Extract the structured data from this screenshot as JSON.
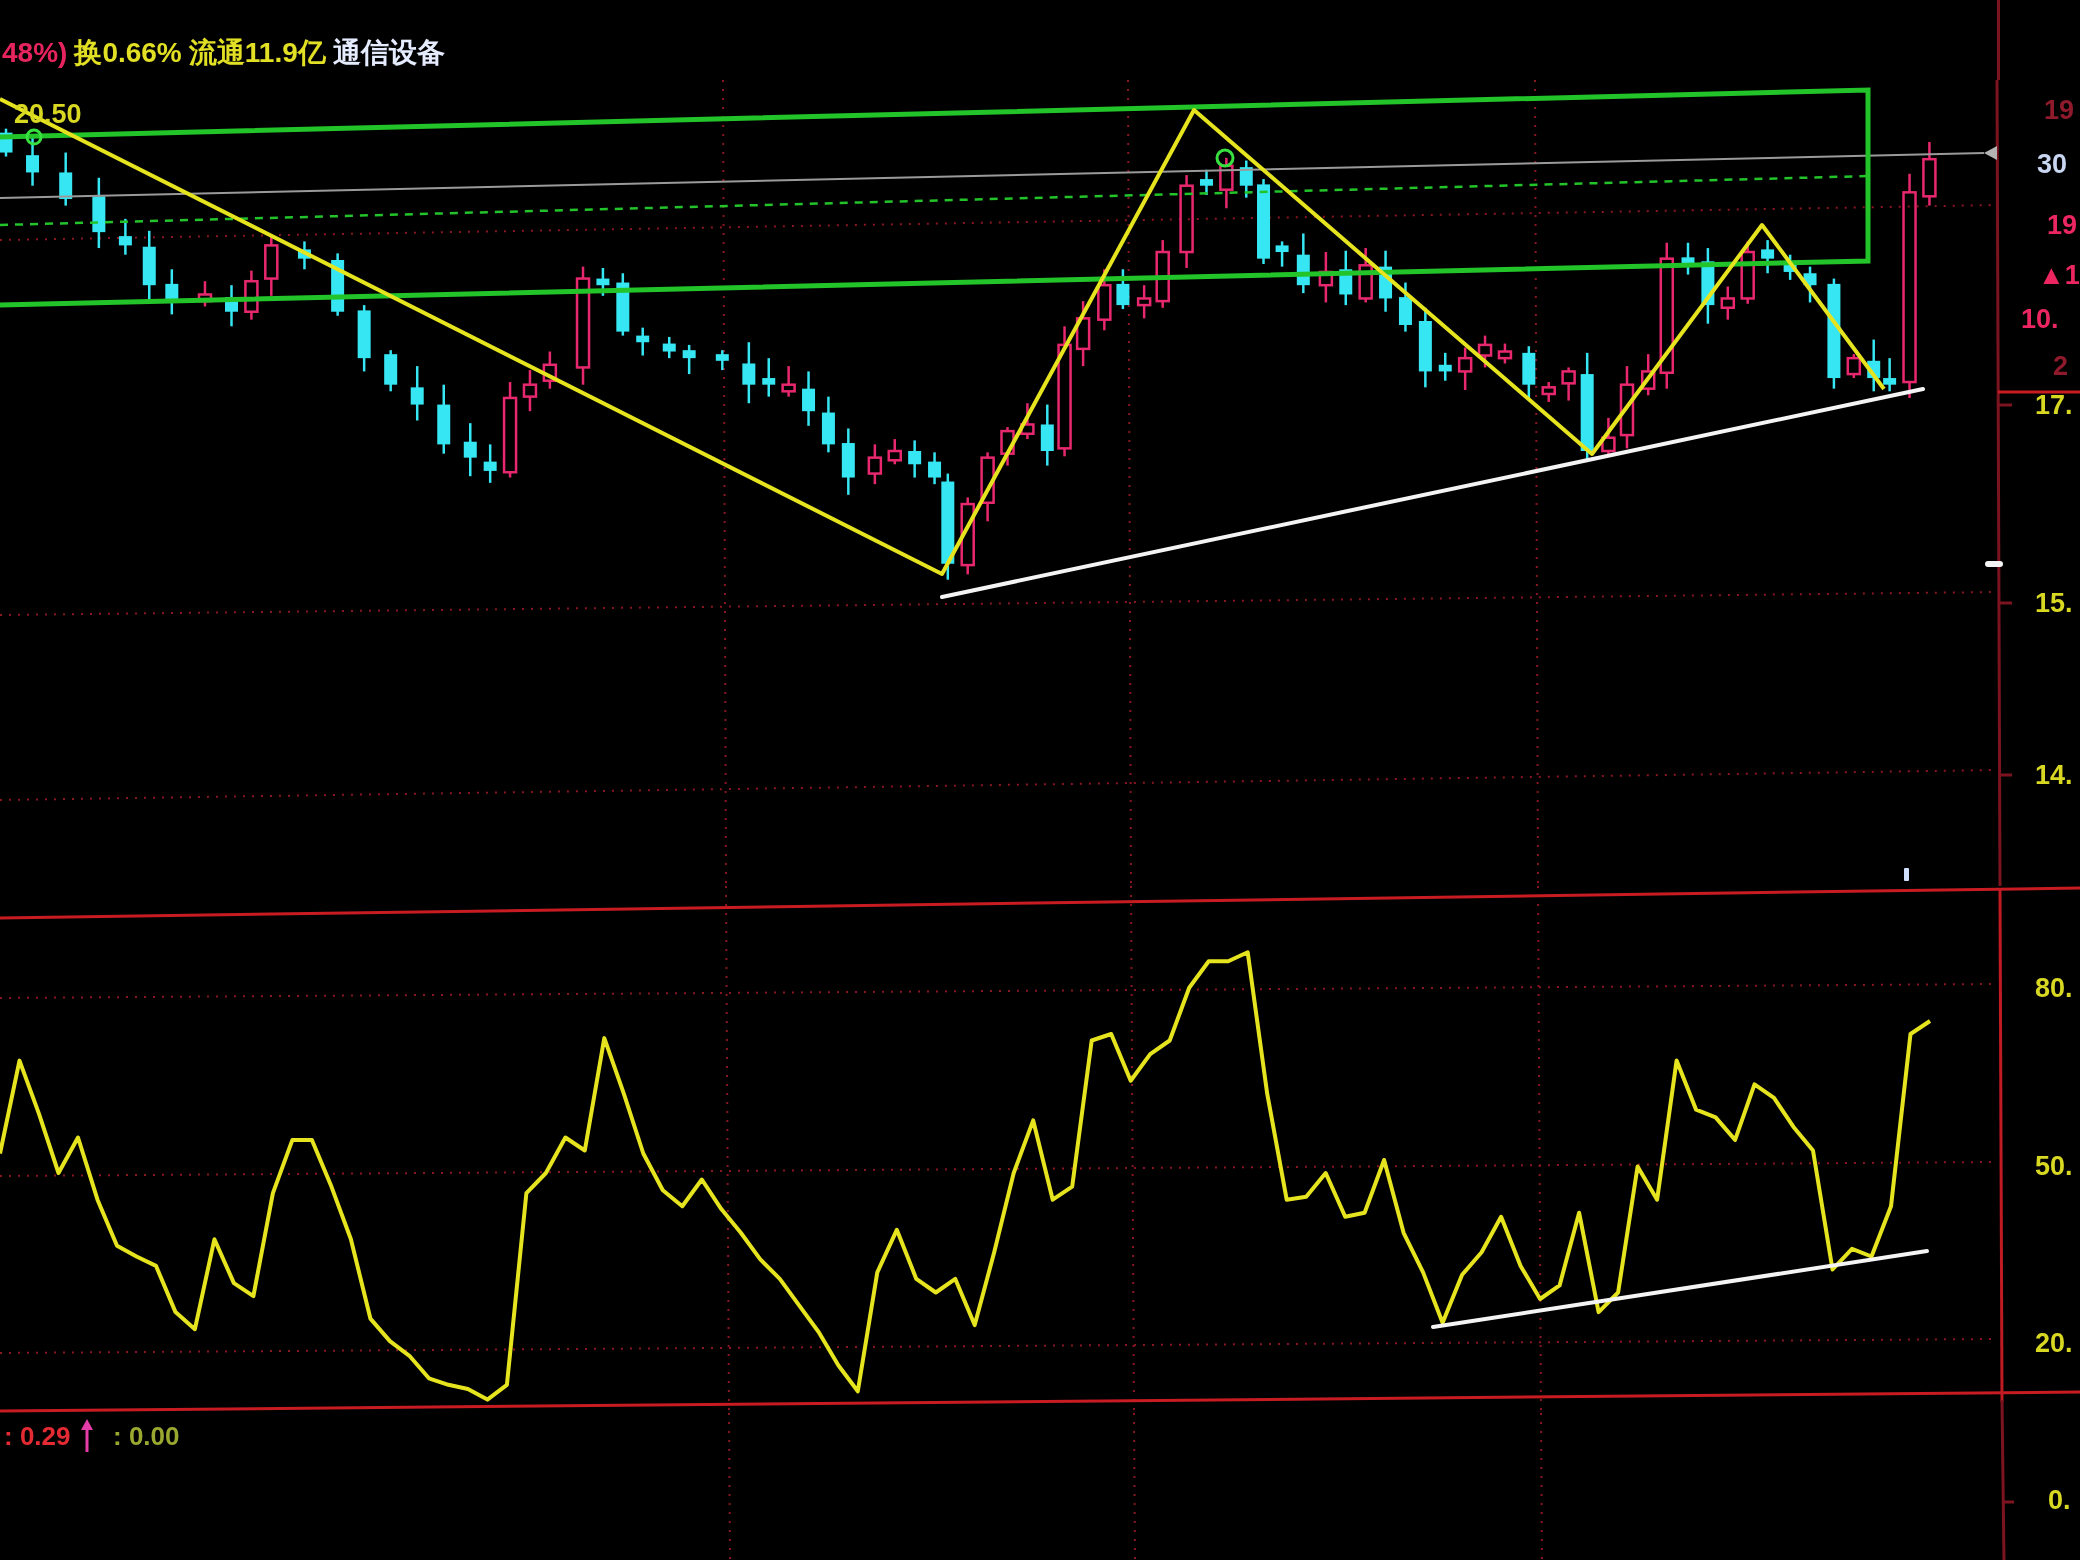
{
  "info_bar": {
    "items": [
      {
        "text": "48%)",
        "kind": "change"
      },
      {
        "text": "换0.66%",
        "kind": "stat"
      },
      {
        "text": "流通11.9亿",
        "kind": "stat"
      },
      {
        "text": "通信设备",
        "kind": "sector"
      }
    ]
  },
  "price_panel": {
    "high_label": "20.50",
    "quote_values": [
      {
        "text": "19",
        "kind": "faint"
      },
      {
        "text": "30",
        "kind": "volume"
      },
      {
        "text": "19",
        "kind": "up"
      },
      {
        "text": "▲1",
        "kind": "up"
      },
      {
        "text": "10.",
        "kind": "up"
      },
      {
        "text": "2",
        "kind": "faint"
      }
    ],
    "axis_labels": [
      "17.",
      "15.",
      "14."
    ]
  },
  "indicator_panel": {
    "axis_labels": [
      "80.",
      "50.",
      "20."
    ]
  },
  "bottom_panel": {
    "axis_labels": [
      "0."
    ],
    "readings": [
      {
        "text": ": 0.29",
        "kind": "up"
      },
      {
        "text": ": 0.00",
        "kind": "flat"
      }
    ]
  }
}
